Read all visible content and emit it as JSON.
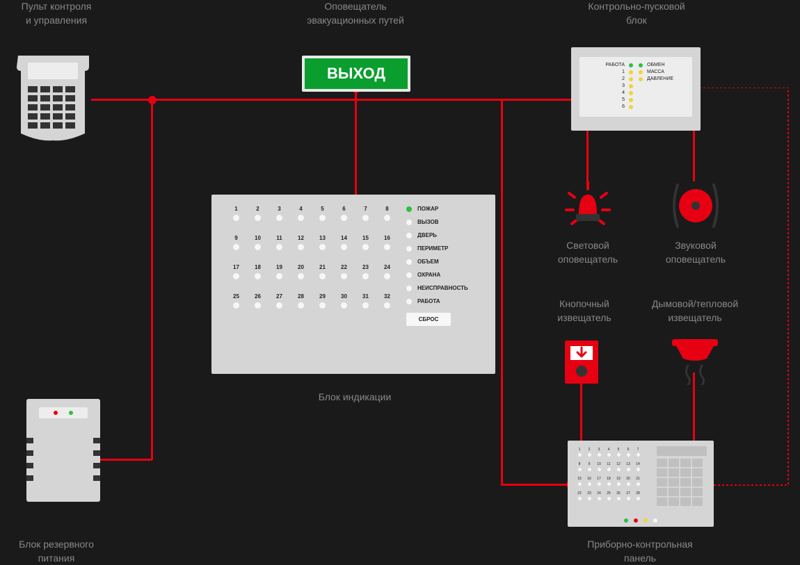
{
  "labels": {
    "keypad": "Пульт контроля\nи управления",
    "exit": "Оповещатель\nэвакуационных путей",
    "ctrl": "Контрольно-пусковой\nблок",
    "strobe": "Световой\nоповещатель",
    "sounder": "Звуковой\nоповещатель",
    "callpoint": "Кнопочный\nизвещатель",
    "smoke": "Дымовой/тепловой\nизвещатель",
    "indication": "Блок индикации",
    "psu": "Блок резервного\nпитания",
    "panel": "Приборно-контрольная\nпанель"
  },
  "exit_text": "ВЫХОД",
  "indication": {
    "zones": [
      [
        "1",
        "2",
        "3",
        "4",
        "5",
        "6",
        "7",
        "8"
      ],
      [
        "9",
        "10",
        "11",
        "12",
        "13",
        "14",
        "15",
        "16"
      ],
      [
        "17",
        "18",
        "19",
        "20",
        "21",
        "22",
        "23",
        "24"
      ],
      [
        "25",
        "26",
        "27",
        "28",
        "29",
        "30",
        "31",
        "32"
      ]
    ],
    "status": [
      {
        "label": "ПОЖАР",
        "color": "green"
      },
      {
        "label": "ВЫЗОВ",
        "color": ""
      },
      {
        "label": "ДВЕРЬ",
        "color": ""
      },
      {
        "label": "ПЕРИМЕТР",
        "color": ""
      },
      {
        "label": "ОБЪЕМ",
        "color": ""
      },
      {
        "label": "ОХРАНА",
        "color": ""
      },
      {
        "label": "НЕИСПРАВНОСТЬ",
        "color": ""
      },
      {
        "label": "РАБОТА",
        "color": ""
      }
    ],
    "reset": "СБРОС"
  },
  "ctrl": {
    "left_top": "РАБОТА",
    "right": [
      "ОБМЕН",
      "МАССА",
      "ДАВЛЕНИЕ"
    ],
    "nums": [
      "1",
      "2",
      "3",
      "4",
      "5",
      "6"
    ]
  },
  "cpanel": {
    "zones": [
      [
        "1",
        "2",
        "3",
        "4",
        "5",
        "6",
        "7"
      ],
      [
        "8",
        "9",
        "10",
        "11",
        "12",
        "13",
        "14"
      ],
      [
        "15",
        "16",
        "17",
        "18",
        "19",
        "20",
        "21"
      ],
      [
        "22",
        "23",
        "24",
        "25",
        "26",
        "27",
        "28"
      ]
    ]
  }
}
